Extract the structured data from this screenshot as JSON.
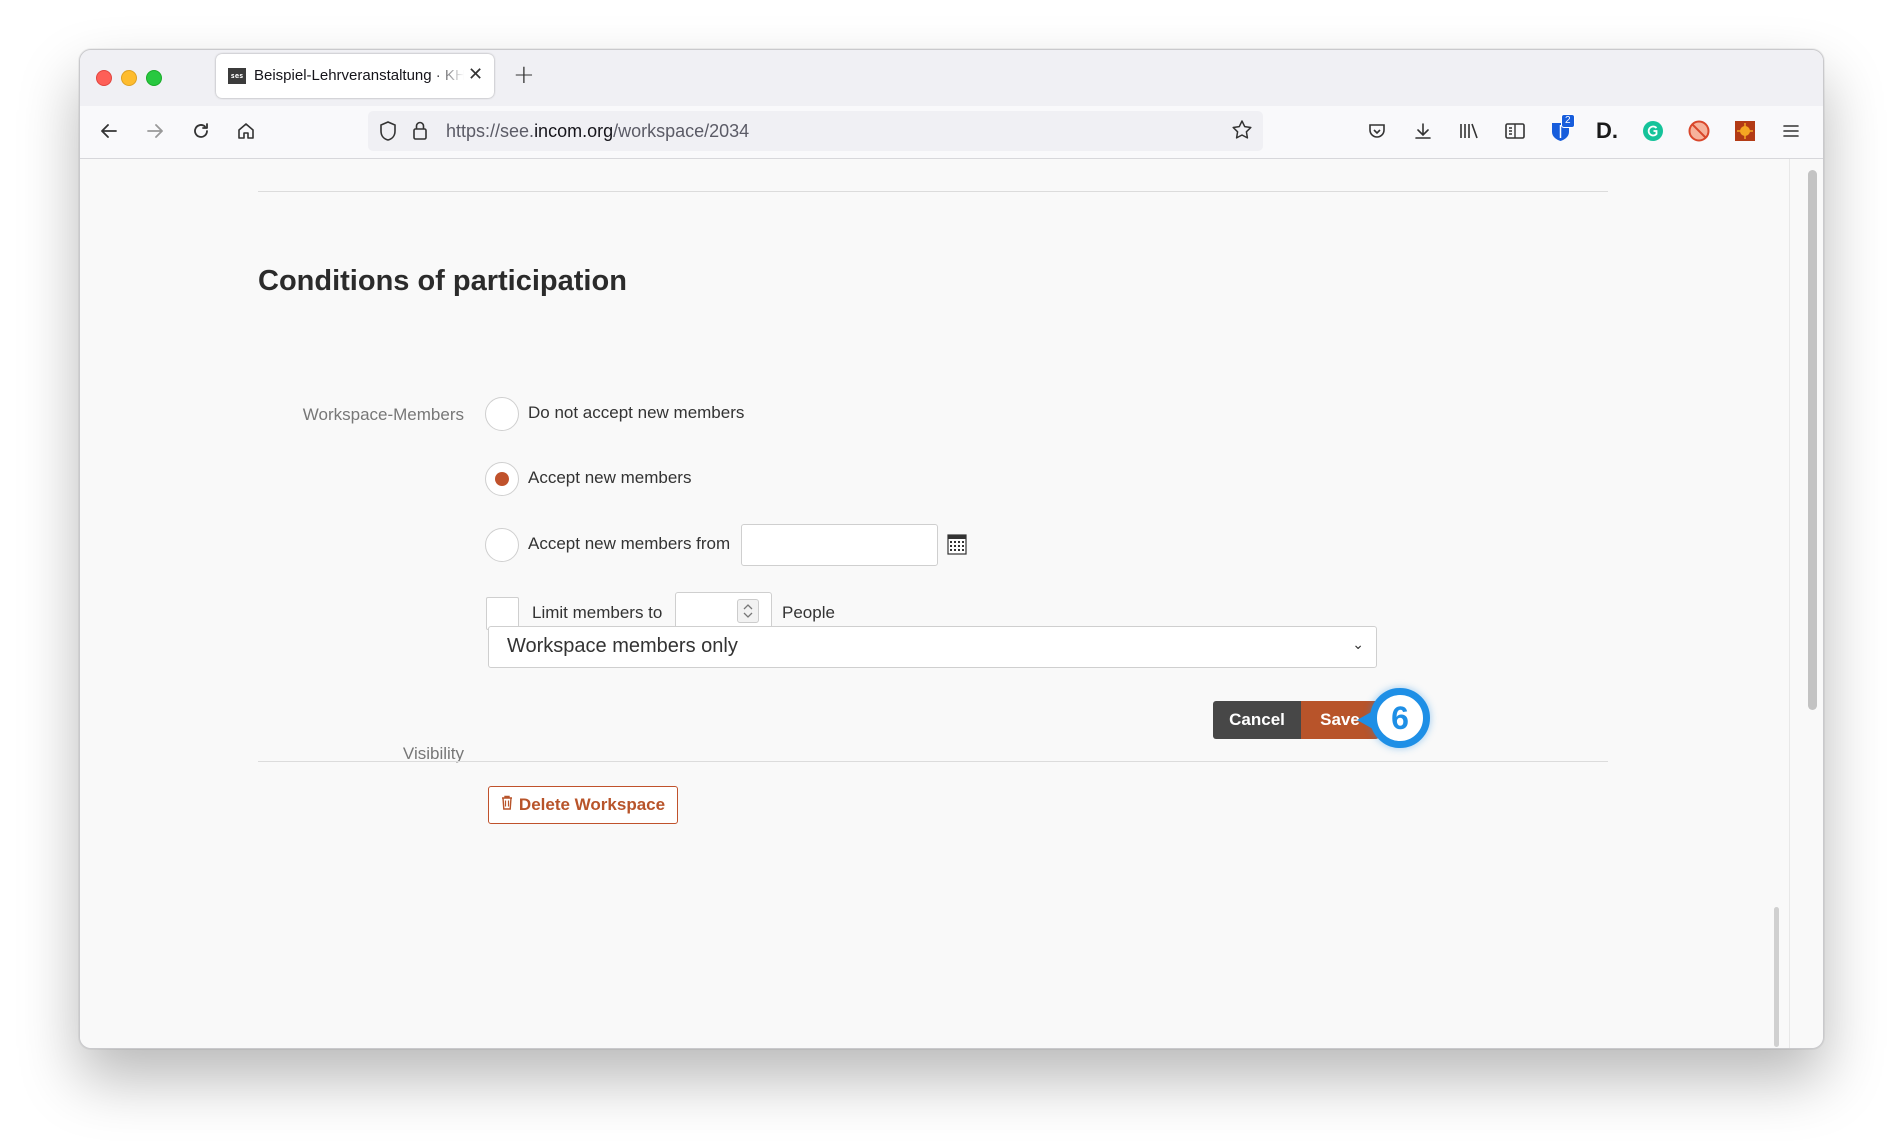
{
  "browser": {
    "tab_title": "Beispiel-Lehrveranstaltung · KHI",
    "tab_favicon_text": "ses",
    "url_prefix": "https://see.",
    "url_host": "incom.org",
    "url_path": "/workspace/2034",
    "toolbar_badge_count": "2"
  },
  "page": {
    "heading": "Conditions of participation",
    "members_label": "Workspace-Members",
    "options": {
      "do_not_accept": "Do not accept new members",
      "accept": "Accept new members",
      "accept_from": "Accept new members from"
    },
    "selected_option": "accept",
    "accept_from_date": "",
    "limit_label": "Limit members to",
    "limit_value": "",
    "limit_unit": "People",
    "visibility_label": "Visibility",
    "visibility_value": "Workspace members only",
    "cancel_label": "Cancel",
    "save_label": "Save",
    "delete_label": "Delete Workspace",
    "step_number": "6"
  },
  "colors": {
    "accent": "#b8542a",
    "step_badge": "#1e8fe6",
    "cancel_bg": "#474747"
  }
}
